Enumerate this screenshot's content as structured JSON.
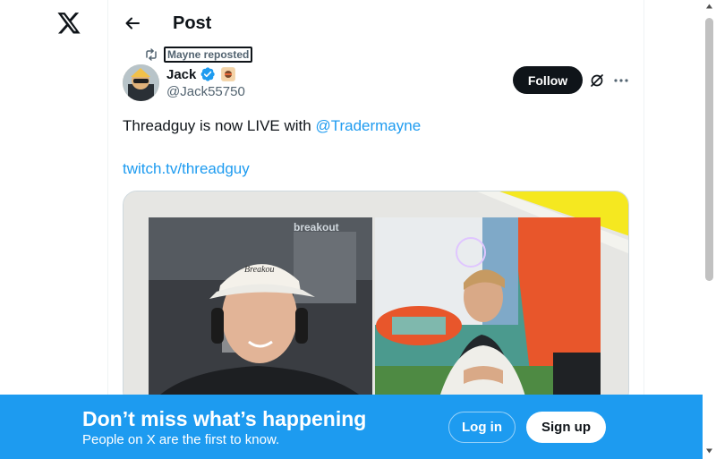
{
  "nav": {
    "logo_icon": "x-logo-icon"
  },
  "header": {
    "title": "Post",
    "back_icon": "arrow-left-icon"
  },
  "repost": {
    "label": "Mayne reposted",
    "icon": "repost-icon"
  },
  "author": {
    "name": "Jack",
    "handle": "@Jack55750",
    "verified": true
  },
  "actions": {
    "follow_label": "Follow",
    "grok_icon": "grok-icon",
    "more_icon": "more-icon"
  },
  "post": {
    "text_prefix": "Threadguy is now LIVE with ",
    "mention": "@Tradermayne",
    "link": "twitch.tv/threadguy"
  },
  "media": {
    "overlay_text": "breakout",
    "cap_text": "Breakou"
  },
  "banner": {
    "title": "Don’t miss what’s happening",
    "subtitle": "People on X are the first to know.",
    "login_label": "Log in",
    "signup_label": "Sign up"
  },
  "colors": {
    "accent": "#1d9bf0",
    "text": "#0f1419",
    "secondary": "#536471"
  }
}
